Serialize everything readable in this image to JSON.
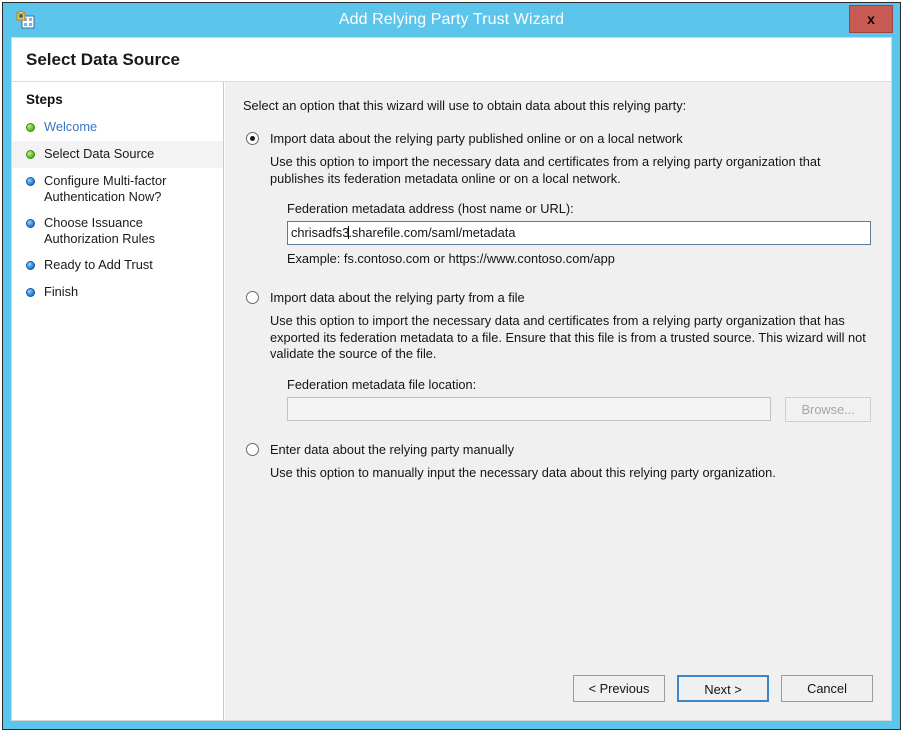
{
  "window": {
    "title": "Add Relying Party Trust Wizard",
    "app_icon": "wizard-app-icon",
    "close_label": "x",
    "titlebar_color": "#5cc5ec",
    "close_button_color": "#c85a54"
  },
  "page": {
    "title": "Select Data Source"
  },
  "sidebar": {
    "heading": "Steps",
    "items": [
      {
        "label": "Welcome",
        "bullet": "green",
        "state": "done",
        "link": true
      },
      {
        "label": "Select Data Source",
        "bullet": "green",
        "state": "current",
        "link": false
      },
      {
        "label": "Configure Multi-factor Authentication Now?",
        "bullet": "blue",
        "state": "pending",
        "link": false
      },
      {
        "label": "Choose Issuance Authorization Rules",
        "bullet": "blue",
        "state": "pending",
        "link": false
      },
      {
        "label": "Ready to Add Trust",
        "bullet": "blue",
        "state": "pending",
        "link": false
      },
      {
        "label": "Finish",
        "bullet": "blue",
        "state": "pending",
        "link": false
      }
    ]
  },
  "main": {
    "intro": "Select an option that this wizard will use to obtain data about this relying party:",
    "options": [
      {
        "label": "Import data about the relying party published online or on a local network",
        "selected": true,
        "description": "Use this option to import the necessary data and certificates from a relying party organization that publishes its federation metadata online or on a local network.",
        "field_label": "Federation metadata address (host name or URL):",
        "field_value_before_caret": "chrisadfs3",
        "field_value_after_caret": ".sharefile.com/saml/metadata",
        "field_value": "chrisadfs3.sharefile.com/saml/metadata",
        "field_placeholder": "",
        "example": "Example: fs.contoso.com or https://www.contoso.com/app"
      },
      {
        "label": "Import data about the relying party from a file",
        "selected": false,
        "description": "Use this option to import the necessary data and certificates from a relying party organization that has exported its federation metadata to a file. Ensure that this file is from a trusted source.  This wizard will not validate the source of the file.",
        "field_label": "Federation metadata file location:",
        "field_value": "",
        "field_placeholder": "",
        "browse_label": "Browse...",
        "disabled": true
      },
      {
        "label": "Enter data about the relying party manually",
        "selected": false,
        "description": "Use this option to manually input the necessary data about this relying party organization."
      }
    ]
  },
  "footer": {
    "previous_label": "< Previous",
    "next_label": "Next >",
    "cancel_label": "Cancel",
    "default_button": "Next >"
  }
}
